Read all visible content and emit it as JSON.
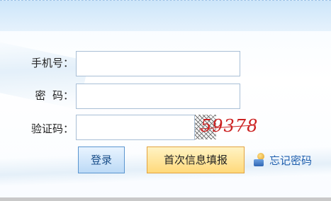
{
  "form": {
    "phone_label": "手机号：",
    "phone_value": "",
    "password_label": "密  码：",
    "password_value": "",
    "captcha_label": "验证码：",
    "captcha_value": "",
    "captcha_image_text": "59378"
  },
  "actions": {
    "login_label": "登录",
    "first_fill_label": "首次信息填报",
    "forgot_label": "忘记密码"
  },
  "colors": {
    "top_band": "#cde6fa",
    "login_button": "#bcdaf6",
    "first_fill_button": "#ffd97a",
    "link": "#1f5fae",
    "captcha_text": "#cc2222"
  },
  "icons": {
    "forgot": "user-key-icon"
  }
}
